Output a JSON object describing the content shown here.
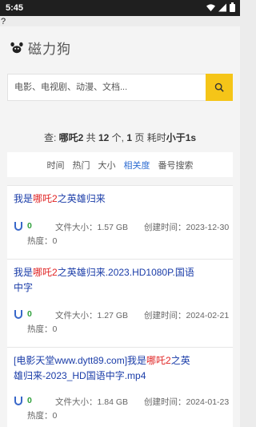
{
  "status_bar": {
    "time": "5:45"
  },
  "stray_char": "?",
  "app": {
    "title": "磁力狗"
  },
  "search": {
    "placeholder": "电影、电视剧、动漫、文档..."
  },
  "summary": {
    "prefix": "查: ",
    "keyword": "哪吒2",
    "p2": " 共 ",
    "count": "12",
    "p3": " 个, ",
    "pages": "1",
    "p4": " 页 耗时",
    "time": "小于1s"
  },
  "sort_options": [
    "时间",
    "热门",
    "大小",
    "相关度",
    "番号搜索"
  ],
  "results": [
    {
      "title_pre": "我是",
      "title_hl": "哪吒2",
      "title_post": "之英雄归来",
      "magnets": "0",
      "size": "文件大小：1.57 GB",
      "date": "创建时间：2023-12-30",
      "heat": "热度：0"
    },
    {
      "title_pre": "我是",
      "title_hl": "哪吒2",
      "title_post": "之英雄归来.2023.HD1080P.国语中字",
      "magnets": "0",
      "size": "文件大小：1.27 GB",
      "date": "创建时间：2024-02-21",
      "heat": "热度：0"
    },
    {
      "title_pre": "[电影天堂www.dytt89.com]我是",
      "title_hl": "哪吒2",
      "title_post": "之英雄归来-2023_HD国语中字.mp4",
      "magnets": "0",
      "size": "文件大小：1.84 GB",
      "date": "创建时间：2024-01-23",
      "heat": "热度：0"
    }
  ],
  "colors": {
    "accent": "#f5c518",
    "link": "#1a3ca8",
    "highlight": "#e02424",
    "count": "#2e9f3a",
    "active_sort": "#2d6cd2"
  }
}
